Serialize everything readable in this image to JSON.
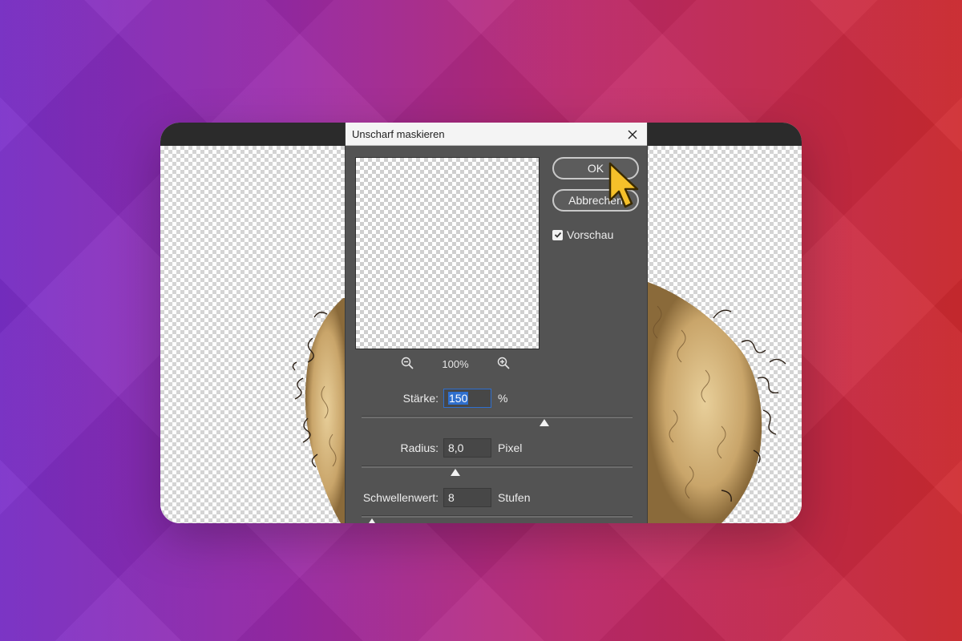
{
  "dialog": {
    "title": "Unscharf maskieren",
    "ok_label": "OK",
    "cancel_label": "Abbrechen",
    "preview_label": "Vorschau",
    "preview_checked": true,
    "zoom_level": "100%",
    "fields": {
      "amount": {
        "label": "Stärke:",
        "value": "150",
        "unit": "%",
        "slider_fraction": 0.67
      },
      "radius": {
        "label": "Radius:",
        "value": "8,0",
        "unit": "Pixel",
        "slider_fraction": 0.34
      },
      "threshold": {
        "label": "Schwellenwert:",
        "value": "8",
        "unit": "Stufen",
        "slider_fraction": 0.03
      }
    }
  },
  "icons": [
    "close-icon",
    "zoom-out-icon",
    "zoom-in-icon",
    "checkmark-icon",
    "mouse-pointer-icon"
  ],
  "colors": {
    "dialog_bg": "#535353",
    "accent_selection": "#2f6fce",
    "cursor_fill": "#f5c02a",
    "background_left": "#7a2fc9",
    "background_right": "#cf2a2f"
  }
}
